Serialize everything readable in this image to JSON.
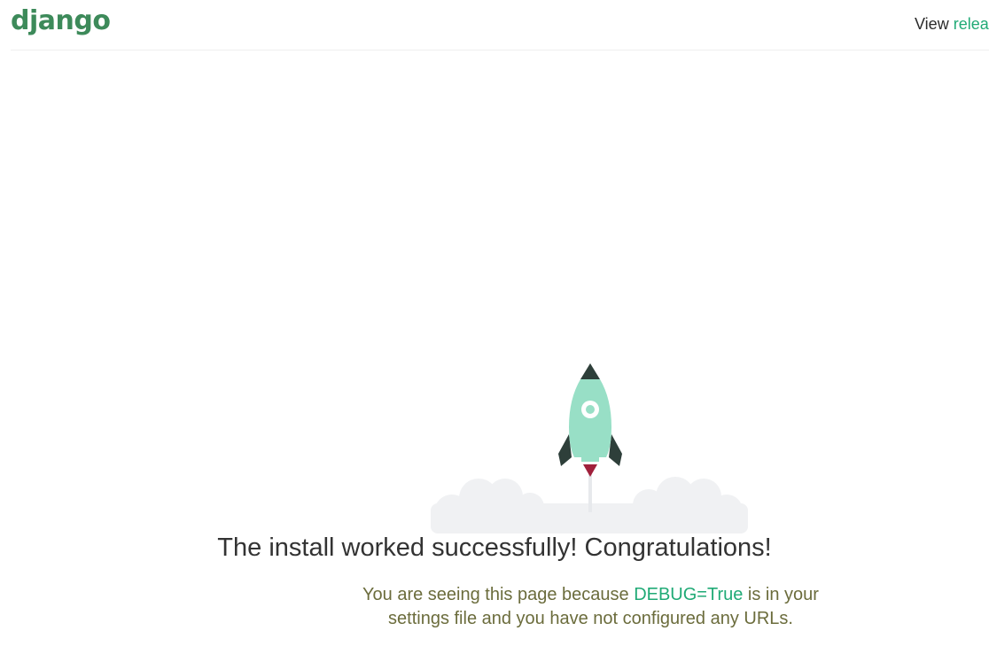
{
  "header": {
    "logo": "django",
    "release_prefix": "View ",
    "release_link": "release notes"
  },
  "main": {
    "title": "The install worked successfully! Congratulations!",
    "subtitle_before": "You are seeing this page because ",
    "subtitle_code": "DEBUG=True",
    "subtitle_after": " is in your settings file and you have not configured any URLs."
  },
  "icons": {
    "rocket": "rocket-icon",
    "clouds": "cloud-icon"
  },
  "colors": {
    "brand": "#3d8a5a",
    "accent": "#20aa76",
    "rocket_body": "#98dfc6",
    "rocket_dark": "#2e3f3a",
    "flame": "#a0203b",
    "cloud": "#f0f1f3"
  }
}
